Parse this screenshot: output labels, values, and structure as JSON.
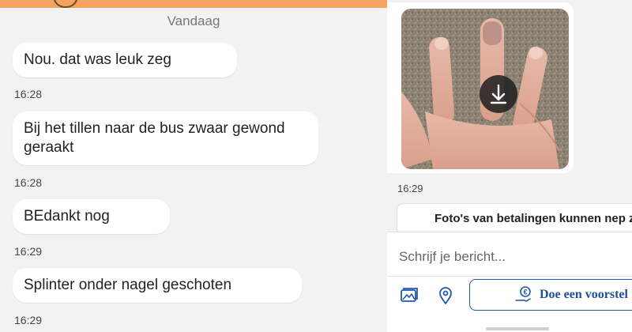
{
  "chat": {
    "date_separator": "Vandaag",
    "messages": [
      {
        "text": "Nou. dat was leuk zeg",
        "time": "16:28"
      },
      {
        "text": "Bij het tillen naar de bus zwaar gewond geraakt",
        "time": "16:28"
      },
      {
        "text": "BEdankt nog",
        "time": "16:29"
      },
      {
        "text": "Splinter onder nagel geschoten",
        "time": "16:29"
      }
    ]
  },
  "attachment": {
    "time": "16:29",
    "icon": "download-icon"
  },
  "notice": {
    "text": "Foto's van betalingen kunnen nep z"
  },
  "composer": {
    "placeholder": "Schrijf je bericht...",
    "offer_label": "Doe een voorstel",
    "icons": [
      "image-icon",
      "location-pin-icon",
      "offer-hand-euro-icon"
    ]
  },
  "colors": {
    "header_accent": "#f4a460",
    "offer_blue": "#1e5aa8"
  }
}
